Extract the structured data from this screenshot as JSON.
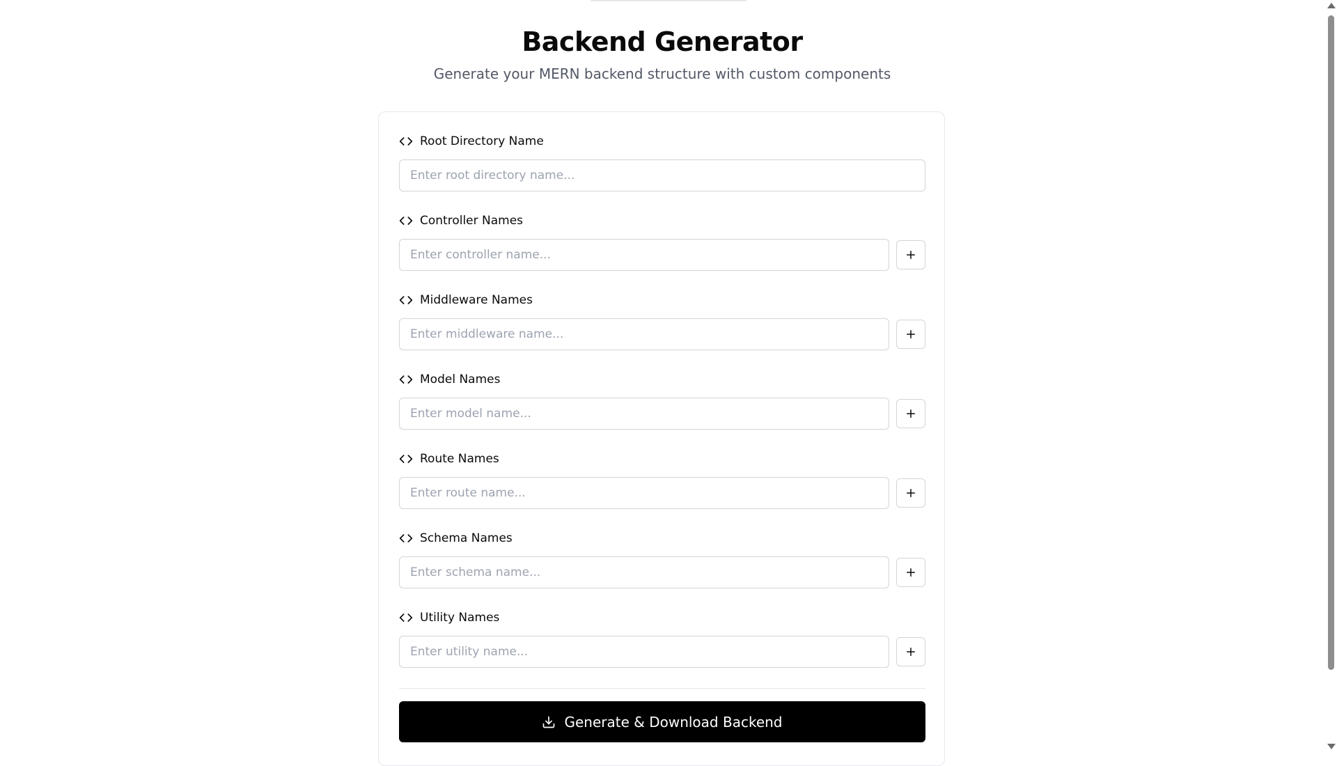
{
  "header": {
    "title": "Backend Generator",
    "subtitle": "Generate your MERN backend structure with custom components"
  },
  "fields": {
    "root": {
      "label": "Root Directory Name",
      "placeholder": "Enter root directory name...",
      "value": ""
    },
    "controller": {
      "label": "Controller Names",
      "placeholder": "Enter controller name...",
      "value": ""
    },
    "middleware": {
      "label": "Middleware Names",
      "placeholder": "Enter middleware name...",
      "value": ""
    },
    "model": {
      "label": "Model Names",
      "placeholder": "Enter model name...",
      "value": ""
    },
    "route": {
      "label": "Route Names",
      "placeholder": "Enter route name...",
      "value": ""
    },
    "schema": {
      "label": "Schema Names",
      "placeholder": "Enter schema name...",
      "value": ""
    },
    "utility": {
      "label": "Utility Names",
      "placeholder": "Enter utility name...",
      "value": ""
    }
  },
  "icons": {
    "field_icon": "code-icon",
    "add_icon": "plus-icon",
    "generate_icon": "download-icon"
  },
  "actions": {
    "generate_label": "Generate & Download Backend"
  },
  "colors": {
    "primary_button": "#000000",
    "primary_button_text": "#ffffff",
    "border": "#d4d4d8",
    "placeholder": "#9ca3af",
    "subtitle": "#525866"
  }
}
